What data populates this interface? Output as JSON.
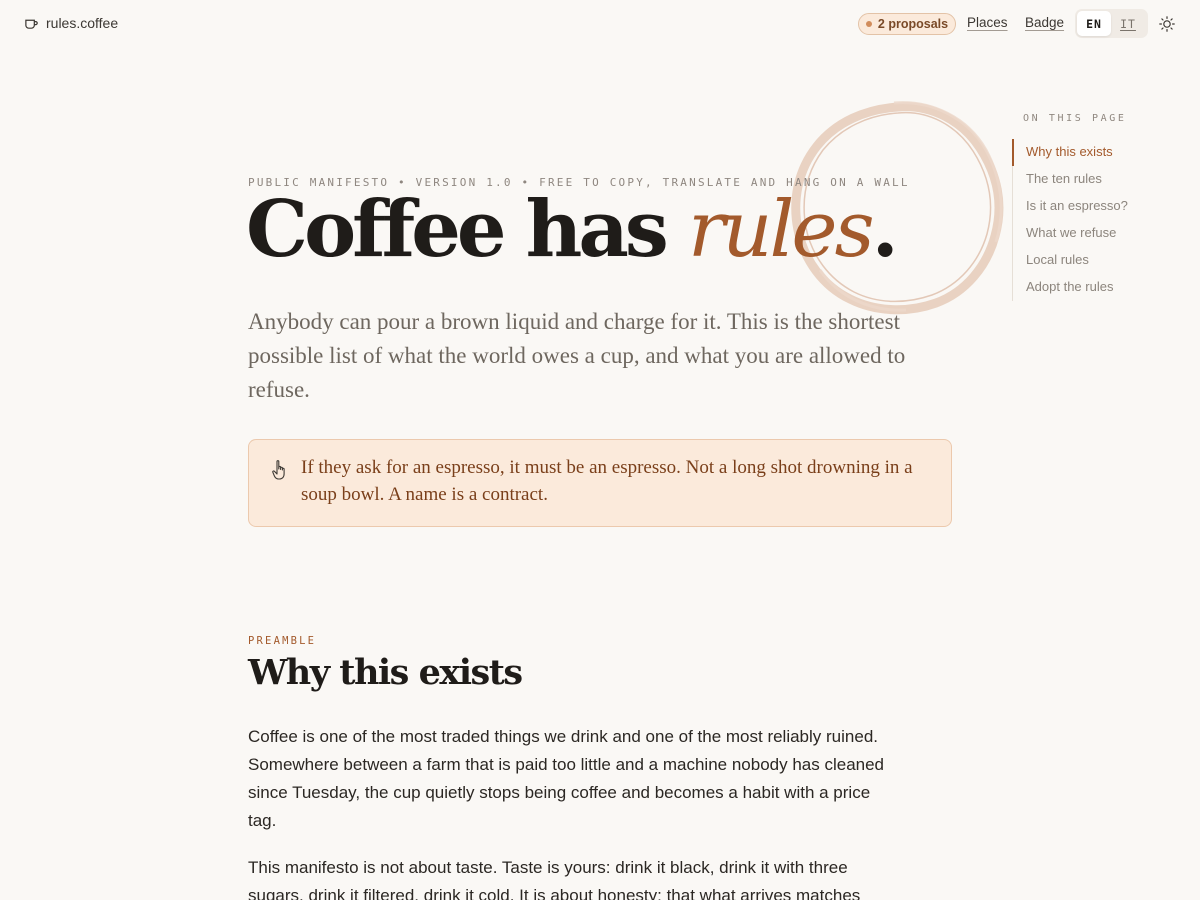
{
  "header": {
    "brand": "rules.coffee",
    "proposals": "2 proposals",
    "nav": {
      "places": "Places",
      "badge": "Badge"
    },
    "languages": [
      {
        "code": "EN",
        "active": true
      },
      {
        "code": "IT",
        "active": false
      }
    ],
    "theme_icon": "sun-icon"
  },
  "hero": {
    "eyebrow": "PUBLIC MANIFESTO • VERSION 1.0 • FREE TO COPY, TRANSLATE AND HANG ON A WALL",
    "title_lead": "Coffee has ",
    "title_emphasis": "rules",
    "title_end": ".",
    "lede": "Anybody can pour a brown liquid and charge for it. This is the shortest possible list of what the world owes a cup, and what you are allowed to refuse.",
    "callout": {
      "icon": "pointing-hand-icon",
      "text": "If they ask for an espresso, it must be an espresso. Not a long shot drowning in a soup bowl. A name is a contract."
    }
  },
  "toc": {
    "title": "ON THIS PAGE",
    "items": [
      {
        "label": "Why this exists",
        "active": true
      },
      {
        "label": "The ten rules",
        "active": false
      },
      {
        "label": "Is it an espresso?",
        "active": false
      },
      {
        "label": "What we refuse",
        "active": false
      },
      {
        "label": "Local rules",
        "active": false
      },
      {
        "label": "Adopt the rules",
        "active": false
      }
    ]
  },
  "preamble": {
    "kicker": "PREAMBLE",
    "title": "Why this exists",
    "paragraphs": [
      "Coffee is one of the most traded things we drink and one of the most reliably ruined. Somewhere between a farm that is paid too little and a machine nobody has cleaned since Tuesday, the cup quietly stops being coffee and becomes a habit with a price tag.",
      "This manifesto is not about taste. Taste is yours: drink it black, drink it with three sugars, drink it filtered, drink it cold. It is about honesty: that what arrives matches"
    ]
  },
  "colors": {
    "accent": "#a35a2c",
    "background": "#faf8f5",
    "callout_bg": "#fbeadb",
    "text": "#1f1c19"
  }
}
